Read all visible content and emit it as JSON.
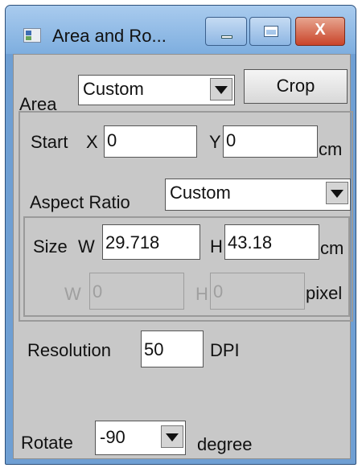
{
  "window": {
    "title": "Area and Ro...",
    "controls": {
      "minimize": "—",
      "maximize": "□",
      "close": "X"
    }
  },
  "area": {
    "label": "Area",
    "selected": "Custom",
    "crop_label": "Crop"
  },
  "start": {
    "label": "Start",
    "x_label": "X",
    "x_value": "0",
    "y_label": "Y",
    "y_value": "0",
    "unit": "cm"
  },
  "aspect": {
    "label": "Aspect Ratio",
    "selected": "Custom"
  },
  "size": {
    "label": "Size",
    "w_label": "W",
    "w_value": "29.718",
    "h_label": "H",
    "h_value": "43.18",
    "unit": "cm",
    "pixel_w_label": "W",
    "pixel_w_value": "0",
    "pixel_h_label": "H",
    "pixel_h_value": "0",
    "pixel_unit": "pixel"
  },
  "resolution": {
    "label": "Resolution",
    "value": "50",
    "unit": "DPI"
  },
  "rotate": {
    "label": "Rotate",
    "selected": "-90",
    "unit": "degree"
  }
}
